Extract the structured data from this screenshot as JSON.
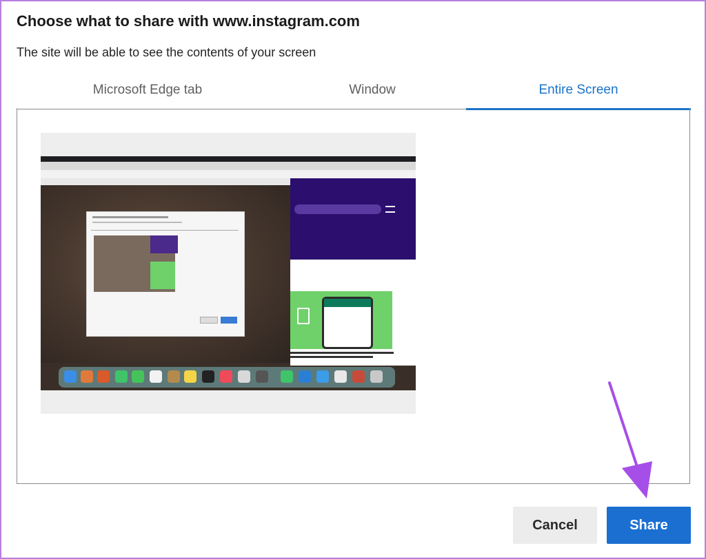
{
  "dialog": {
    "title": "Choose what to share with www.instagram.com",
    "subtitle": "The site will be able to see the contents of your screen"
  },
  "tabs": [
    {
      "label": "Microsoft Edge tab",
      "selected": false
    },
    {
      "label": "Window",
      "selected": false
    },
    {
      "label": "Entire Screen",
      "selected": true
    }
  ],
  "buttons": {
    "cancel_label": "Cancel",
    "share_label": "Share"
  },
  "colors": {
    "accent": "#1a73c8",
    "share_button": "#1a6fd1",
    "annotation_arrow": "#a64fe8",
    "frame_border": "#b77fe0"
  },
  "icons": [
    "screen-thumbnail",
    "purple-arrow-annotation"
  ]
}
